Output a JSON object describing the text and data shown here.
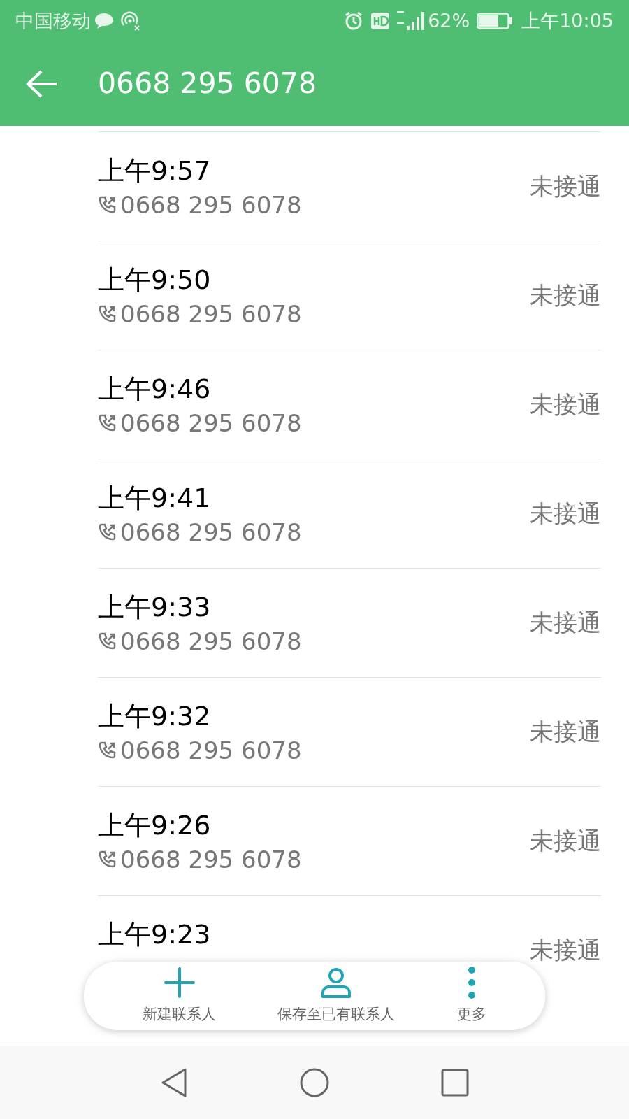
{
  "status_bar": {
    "carrier": "中国移动",
    "battery": "62%",
    "time": "上午10:05"
  },
  "header": {
    "title": "0668 295 6078"
  },
  "calls": [
    {
      "time": "上午9:57",
      "number": "0668 295 6078",
      "status": "未接通"
    },
    {
      "time": "上午9:50",
      "number": "0668 295 6078",
      "status": "未接通"
    },
    {
      "time": "上午9:46",
      "number": "0668 295 6078",
      "status": "未接通"
    },
    {
      "time": "上午9:41",
      "number": "0668 295 6078",
      "status": "未接通"
    },
    {
      "time": "上午9:33",
      "number": "0668 295 6078",
      "status": "未接通"
    },
    {
      "time": "上午9:32",
      "number": "0668 295 6078",
      "status": "未接通"
    },
    {
      "time": "上午9:26",
      "number": "0668 295 6078",
      "status": "未接通"
    },
    {
      "time": "上午9:23",
      "status": "未接通"
    }
  ],
  "action_bar": [
    {
      "kind": "add",
      "label": "新建联系人"
    },
    {
      "kind": "contact",
      "label": "保存至已有联系人"
    },
    {
      "kind": "more",
      "label": "更多"
    }
  ]
}
